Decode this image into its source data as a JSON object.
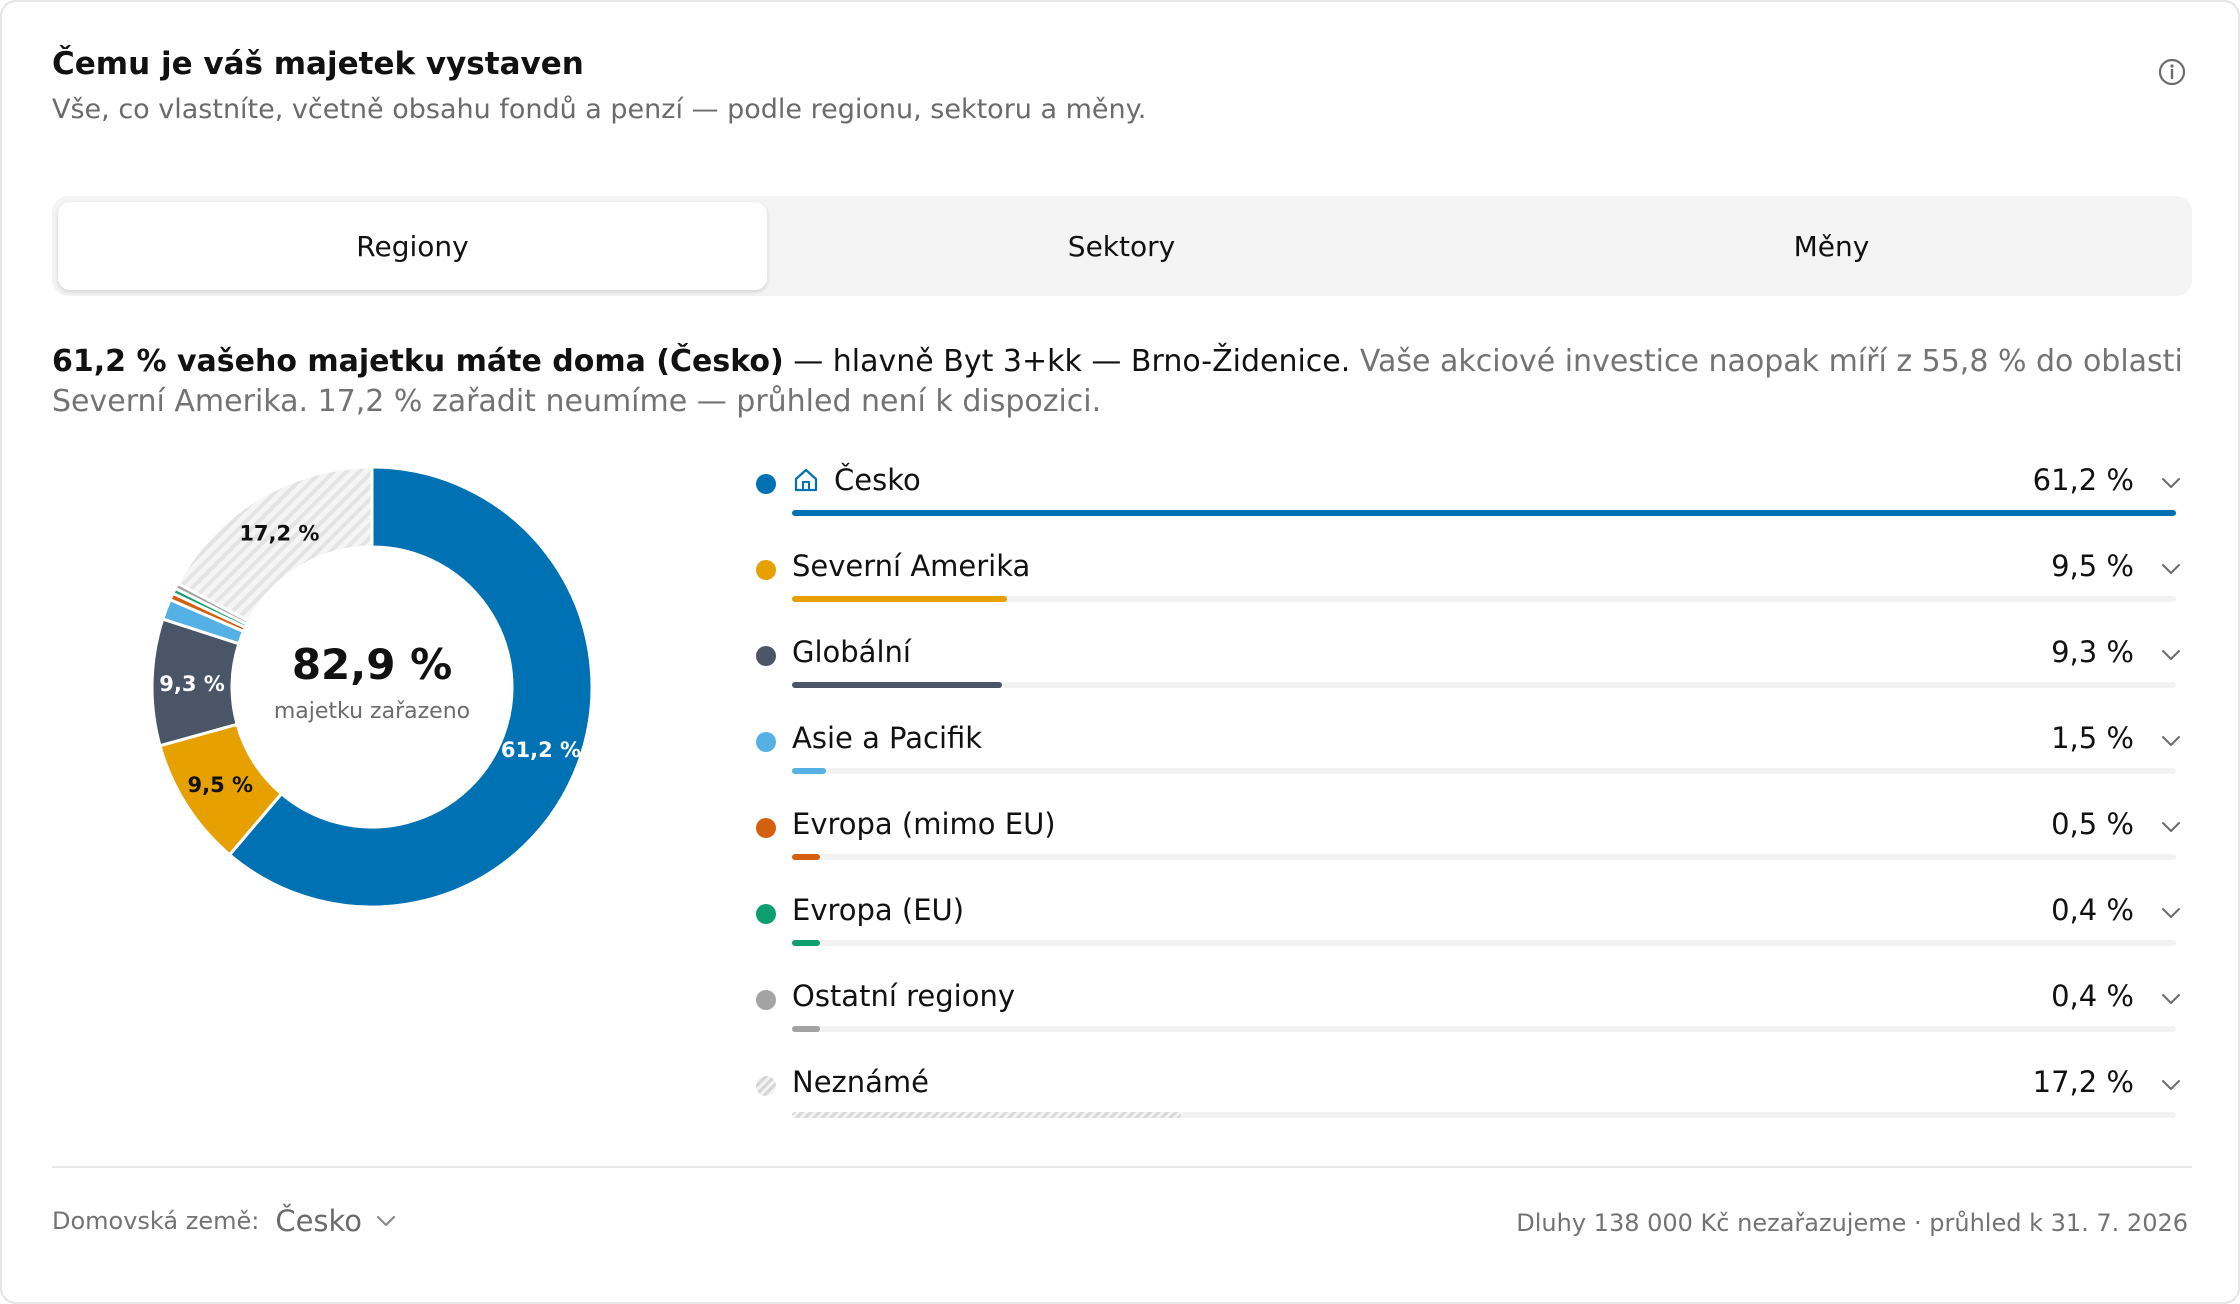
{
  "header": {
    "title": "Čemu je váš majetek vystaven",
    "subtitle": "Vše, co vlastníte, včetně obsahu fondů a penzí — podle regionu, sektoru a měny.",
    "info_icon": "info-circle-icon"
  },
  "tabs": [
    {
      "label": "Regiony",
      "active": true
    },
    {
      "label": "Sektory",
      "active": false
    },
    {
      "label": "Měny",
      "active": false
    }
  ],
  "summary": {
    "bold": "61,2 % vašeho majetku máte doma (Česko)",
    "main": " — hlavně Byt 3+kk — Brno-Židenice.",
    "muted": " Vaše akciové investice naopak míří z 55,8 % do oblasti Severní Amerika. 17,2 % zařadit neumíme — průhled není k dispozici."
  },
  "donut": {
    "center_value": "82,9 %",
    "center_caption": "majetku zařazeno"
  },
  "chart_data": {
    "type": "pie",
    "categories": [
      "Česko",
      "Severní Amerika",
      "Globální",
      "Asie a Pacifik",
      "Evropa (mimo EU)",
      "Evropa (EU)",
      "Ostatní regiony",
      "Neznámé"
    ],
    "values": [
      61.2,
      9.5,
      9.3,
      1.5,
      0.5,
      0.4,
      0.4,
      17.2
    ],
    "value_labels": [
      "61,2 %",
      "9,5 %",
      "9,3 %",
      "1,5 %",
      "0,5 %",
      "0,4 %",
      "0,4 %",
      "17,2 %"
    ],
    "slice_labels_shown": [
      true,
      true,
      true,
      false,
      false,
      false,
      false,
      true
    ],
    "colors": [
      "#0071b3",
      "#e6a000",
      "#4a5568",
      "#55b0e6",
      "#d4600f",
      "#0e9f6e",
      "#a3a3a3",
      "hatch"
    ],
    "legend_placement": "right"
  },
  "legend": {
    "home_icon": "home-icon",
    "chevron_icon": "chevron-down-icon"
  },
  "footer": {
    "home_country_label": "Domovská země:",
    "home_country_value": "Česko",
    "note": "Dluhy 138 000 Kč nezařazujeme · průhled k 31. 7. 2026"
  }
}
